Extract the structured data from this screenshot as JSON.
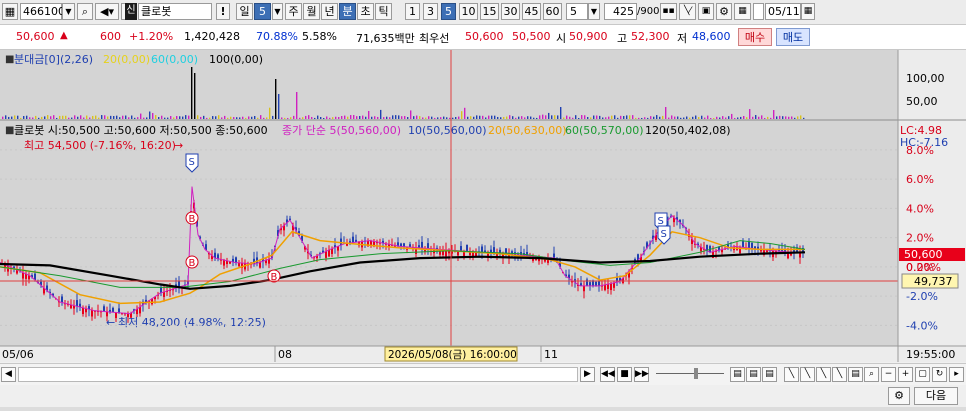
{
  "toolbar": {
    "code": "466100",
    "badge": "신",
    "name": "클로봇",
    "exclaim": "!",
    "period_buttons": [
      "일",
      "5",
      "주",
      "월",
      "년",
      "분",
      "초",
      "틱"
    ],
    "minute_buttons": [
      "1",
      "3",
      "5",
      "10",
      "15",
      "30",
      "45",
      "60"
    ],
    "interval": "5",
    "count": "425",
    "count_total": "/900",
    "date": "05/11"
  },
  "pricebar": {
    "price": "50,600",
    "change": "600",
    "change_pct": "+1.20%",
    "volume": "1,420,428",
    "ratio1": "70.88%",
    "ratio2": "5.58%",
    "amount": "71,635백만",
    "best_label": "최우선",
    "best_sell": "50,600",
    "best_buy": "50,500",
    "open_label": "시",
    "open": "50,900",
    "high_label": "고",
    "high": "52,300",
    "low_label": "저",
    "low": "48,600",
    "buy_btn": "매수",
    "sell_btn": "매도"
  },
  "volume_panel": {
    "legend": [
      {
        "text": "분대금[0](2,26)",
        "color": "#1f3fb0"
      },
      {
        "text": "20(0,00)",
        "color": "#e6d21c"
      },
      {
        "text": "60(0,00)",
        "color": "#1fd0e0"
      },
      {
        "text": "100(0,00)",
        "color": "#000000"
      }
    ],
    "yticks": [
      "100,00",
      "50,00"
    ]
  },
  "price_panel": {
    "legend_main": "클로봇 시:50,500 고:50,600 저:50,500 종:50,600",
    "legend_ma": [
      {
        "text": "종가 단순 5(50,560,00)",
        "color": "#d020c0"
      },
      {
        "text": "10(50,560,00)",
        "color": "#1f3fb0"
      },
      {
        "text": "20(50,630,00)",
        "color": "#f0a000"
      },
      {
        "text": "60(50,570,00)",
        "color": "#1a9a30"
      },
      {
        "text": "120(50,402,08)",
        "color": "#000000"
      }
    ],
    "high_note": "최고 54,500 (-7.16%, 16:20)",
    "low_note": "최저 48,200 (4.98%, 12:25)",
    "lc": "LC:4.98",
    "hc": "HC:-7.16",
    "yticks": [
      "8.0%",
      "6.0%",
      "4.0%",
      "2.0%",
      "0.0%",
      "-2.0%",
      "-4.0%"
    ],
    "current_tag": "50,600",
    "current_pct": "0.20%",
    "ref_tag": "49,737",
    "markers": {
      "s": "S",
      "b": "B"
    }
  },
  "xaxis": {
    "labels": [
      "05/06",
      "08",
      "11"
    ],
    "cursor_time": "2026/05/08(금) 16:00:00",
    "right_time": "19:55:00"
  },
  "bottom": {
    "next_btn": "다음"
  },
  "chart_data": {
    "type": "line",
    "title": "",
    "ylabel": "",
    "ylim": [
      -5.0,
      9.5
    ],
    "x_categories": [
      "05/06",
      "08",
      "11"
    ],
    "series": [
      {
        "name": "5",
        "points": [
          [
            0,
            0.3
          ],
          [
            30,
            -0.6
          ],
          [
            60,
            -2.4
          ],
          [
            95,
            -3.0
          ],
          [
            130,
            -3.2
          ],
          [
            160,
            -1.8
          ],
          [
            188,
            -1.2
          ],
          [
            192,
            5.5
          ],
          [
            198,
            2.2
          ],
          [
            205,
            1.2
          ],
          [
            215,
            0.6
          ],
          [
            235,
            0.3
          ],
          [
            255,
            0.2
          ],
          [
            272,
            0.6
          ],
          [
            280,
            2.6
          ],
          [
            290,
            3.2
          ],
          [
            300,
            2.0
          ],
          [
            312,
            0.6
          ],
          [
            330,
            1.2
          ],
          [
            345,
            1.6
          ],
          [
            370,
            1.8
          ],
          [
            400,
            1.4
          ],
          [
            440,
            1.2
          ],
          [
            480,
            1.0
          ],
          [
            520,
            0.8
          ],
          [
            555,
            0.6
          ],
          [
            565,
            -0.6
          ],
          [
            580,
            -1.3
          ],
          [
            600,
            -1.3
          ],
          [
            620,
            -1.0
          ],
          [
            640,
            0.6
          ],
          [
            660,
            2.6
          ],
          [
            672,
            3.5
          ],
          [
            684,
            2.8
          ],
          [
            695,
            1.6
          ],
          [
            710,
            1.0
          ],
          [
            735,
            1.4
          ],
          [
            760,
            1.2
          ],
          [
            790,
            1.0
          ],
          [
            805,
            1.0
          ]
        ]
      },
      {
        "name": "20",
        "points": [
          [
            0,
            0.0
          ],
          [
            40,
            -0.4
          ],
          [
            80,
            -1.9
          ],
          [
            120,
            -2.5
          ],
          [
            160,
            -2.4
          ],
          [
            190,
            -1.8
          ],
          [
            200,
            -1.4
          ],
          [
            220,
            -0.5
          ],
          [
            250,
            0.2
          ],
          [
            272,
            0.8
          ],
          [
            292,
            2.4
          ],
          [
            320,
            1.8
          ],
          [
            350,
            1.6
          ],
          [
            400,
            1.3
          ],
          [
            450,
            1.1
          ],
          [
            500,
            0.9
          ],
          [
            550,
            0.5
          ],
          [
            575,
            0.0
          ],
          [
            600,
            -0.9
          ],
          [
            625,
            -0.6
          ],
          [
            650,
            0.8
          ],
          [
            672,
            2.4
          ],
          [
            700,
            2.0
          ],
          [
            730,
            1.3
          ],
          [
            760,
            1.2
          ],
          [
            805,
            1.2
          ]
        ]
      },
      {
        "name": "60",
        "points": [
          [
            0,
            0.0
          ],
          [
            60,
            -0.6
          ],
          [
            120,
            -1.4
          ],
          [
            180,
            -1.4
          ],
          [
            230,
            -1.0
          ],
          [
            280,
            -0.1
          ],
          [
            320,
            0.5
          ],
          [
            380,
            0.9
          ],
          [
            450,
            1.1
          ],
          [
            520,
            0.9
          ],
          [
            570,
            0.4
          ],
          [
            610,
            0.1
          ],
          [
            650,
            0.3
          ],
          [
            700,
            1.0
          ],
          [
            740,
            1.8
          ],
          [
            770,
            1.6
          ],
          [
            805,
            1.2
          ]
        ]
      },
      {
        "name": "120",
        "points": [
          [
            0,
            0.2
          ],
          [
            50,
            0.1
          ],
          [
            110,
            -0.6
          ],
          [
            160,
            -1.2
          ],
          [
            190,
            -1.5
          ],
          [
            230,
            -1.3
          ],
          [
            270,
            -0.9
          ],
          [
            310,
            -0.3
          ],
          [
            360,
            0.3
          ],
          [
            420,
            0.6
          ],
          [
            480,
            0.7
          ],
          [
            540,
            0.6
          ],
          [
            600,
            0.3
          ],
          [
            650,
            0.4
          ],
          [
            700,
            0.7
          ],
          [
            760,
            0.9
          ],
          [
            805,
            1.0
          ]
        ]
      }
    ]
  }
}
